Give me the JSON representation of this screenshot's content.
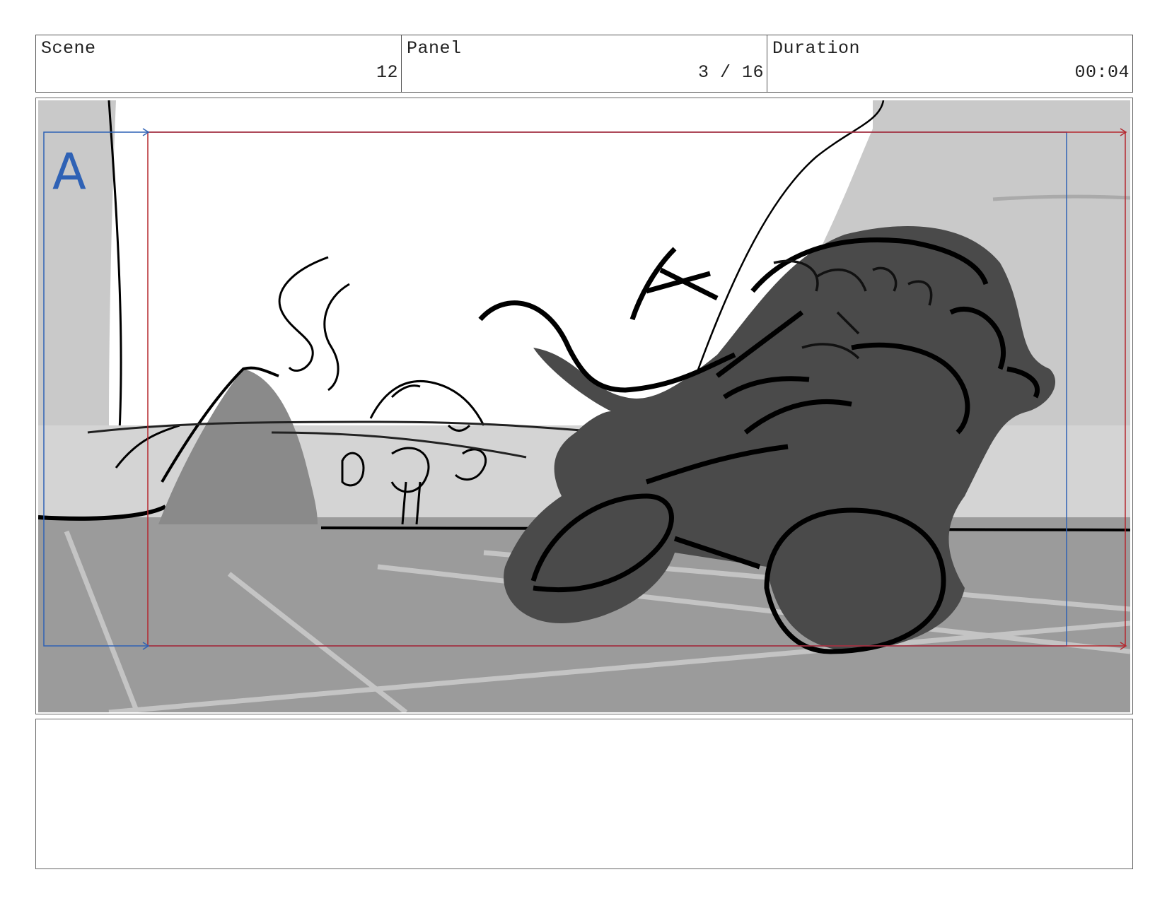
{
  "header": {
    "scene_label": "Scene",
    "scene_value": "12",
    "panel_label": "Panel",
    "panel_value": "3 / 16",
    "duration_label": "Duration",
    "duration_value": "00:04"
  },
  "frame": {
    "safe_area_marker": "A",
    "guide_colors": {
      "action_safe": "#2f62b5",
      "title_safe": "#b5282f"
    }
  },
  "notes": {
    "text": ""
  }
}
